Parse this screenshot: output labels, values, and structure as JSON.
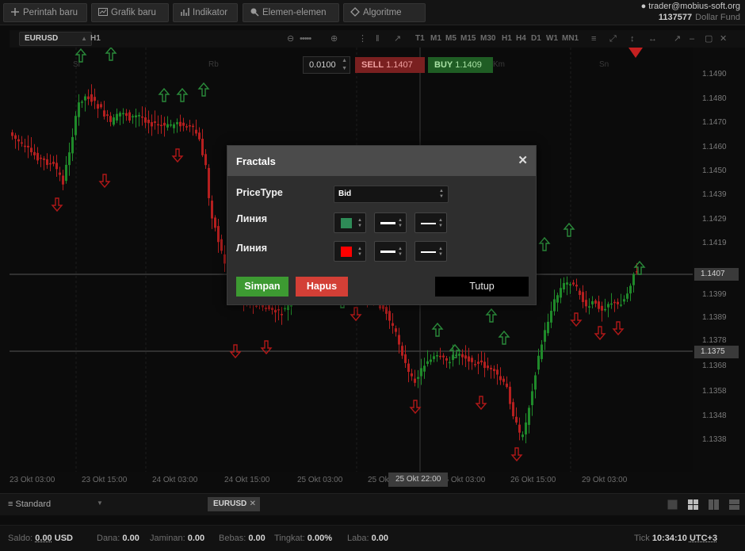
{
  "menu": {
    "new_order": "Perintah baru",
    "new_chart": "Grafik baru",
    "indicator": "Indikator",
    "elements": "Elemen-elemen",
    "algorithm": "Algoritme"
  },
  "account": {
    "user": "trader@mobius-soft.org",
    "number": "1137577",
    "fund": "Dollar Fund"
  },
  "chart": {
    "symbol": "EURUSD",
    "timeframe": "H1",
    "timeframes": [
      "T1",
      "M1",
      "M5",
      "M15",
      "M30",
      "H1",
      "H4",
      "D1",
      "W1",
      "MN1"
    ],
    "price_ticks": [
      "1.1490",
      "1.1480",
      "1.1470",
      "1.1460",
      "1.1450",
      "1.1439",
      "1.1429",
      "1.1419",
      "1.1399",
      "1.1389",
      "1.1378",
      "1.1368",
      "1.1358",
      "1.1348",
      "1.1338"
    ],
    "price_labels": [
      "1.1407",
      "1.1375"
    ],
    "time_ticks": [
      "23 Okt 03:00",
      "23 Okt 15:00",
      "24 Okt 03:00",
      "24 Okt 15:00",
      "25 Okt 03:00",
      "25 Okt 15:00",
      "26 Okt 03:00",
      "26 Okt 15:00",
      "29 Okt 03:00"
    ],
    "time_cursor": "25 Okt 22:00",
    "day_labels": [
      "Sl",
      "Rb",
      "Km",
      "Sn"
    ],
    "colors": {
      "bull": "#1f8a2a",
      "bear": "#b51f1f",
      "up_fractal": "#2a8a3a",
      "down_fractal": "#b01818"
    }
  },
  "order": {
    "lot": "0.0100",
    "sell_label": "SELL",
    "sell_price": "1.1407",
    "buy_label": "BUY",
    "buy_price": "1.1409"
  },
  "dialog": {
    "title": "Fractals",
    "pricetype_label": "PriceType",
    "pricetype_value": "Bid",
    "line1_label": "Линия",
    "line1_color": "#2e8b57",
    "line2_label": "Линия",
    "line2_color": "#ff0000",
    "save": "Simpan",
    "delete": "Hapus",
    "close": "Tutup"
  },
  "bottom": {
    "layout": "Standard",
    "tab": "EURUSD"
  },
  "status": {
    "balance_label": "Saldo:",
    "balance_value": "0.00",
    "balance_currency": "USD",
    "funds_label": "Dana:",
    "funds_value": "0.00",
    "margin_label": "Jaminan:",
    "margin_value": "0.00",
    "free_label": "Bebas:",
    "free_value": "0.00",
    "level_label": "Tingkat:",
    "level_value": "0.00%",
    "profit_label": "Laba:",
    "profit_value": "0.00",
    "tick_label": "Tick",
    "time": "10:34:10",
    "tz": "UTC+3"
  }
}
